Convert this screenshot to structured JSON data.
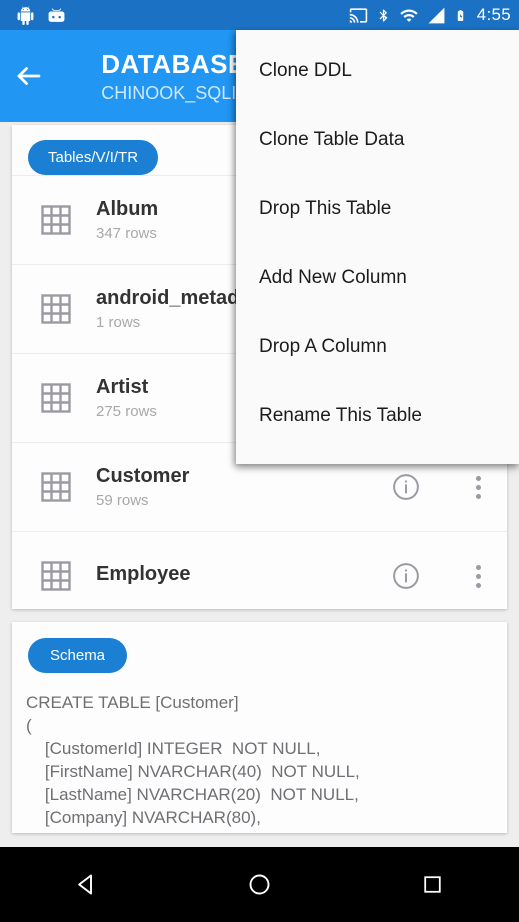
{
  "status_bar": {
    "notification_icons": [
      "android-robot-icon",
      "android-face-icon"
    ],
    "system_icons": [
      "cast-icon",
      "bluetooth-icon",
      "wifi-icon",
      "signal-icon",
      "battery-charging-icon"
    ],
    "time": "4:55",
    "background_color": "#1b72c4"
  },
  "app_bar": {
    "back_icon": "arrow-back-icon",
    "title": "DATABASE",
    "subtitle": "CHINOOK_SQLITE_AUTOINCREMENT_PKS.sqlite",
    "background_color": "#2196f3"
  },
  "tables_card": {
    "chip_label": "Tables/V/I/TR",
    "rows": [
      {
        "name": "Album",
        "subtitle": "347 rows",
        "icon": "table-grid-icon"
      },
      {
        "name": "android_metadata",
        "subtitle": "1 rows",
        "icon": "table-grid-icon"
      },
      {
        "name": "Artist",
        "subtitle": "275 rows",
        "icon": "table-grid-icon"
      },
      {
        "name": "Customer",
        "subtitle": "59 rows",
        "icon": "table-grid-icon"
      },
      {
        "name": "Employee",
        "subtitle": "",
        "icon": "table-grid-icon"
      }
    ],
    "row_action_icons": [
      "info-icon",
      "overflow-menu-icon"
    ]
  },
  "schema_card": {
    "chip_label": "Schema",
    "sql": "CREATE TABLE [Customer]\n(\n    [CustomerId] INTEGER  NOT NULL,\n    [FirstName] NVARCHAR(40)  NOT NULL,\n    [LastName] NVARCHAR(20)  NOT NULL,\n    [Company] NVARCHAR(80),"
  },
  "fab": {
    "label": "+",
    "icon": "plus-icon",
    "color": "#dd38e8"
  },
  "popup_menu": {
    "items": [
      {
        "label": "Clone DDL"
      },
      {
        "label": "Clone Table Data"
      },
      {
        "label": "Drop This Table"
      },
      {
        "label": "Add New Column"
      },
      {
        "label": "Drop A Column"
      },
      {
        "label": "Rename This Table"
      }
    ]
  },
  "nav_bar": {
    "back_icon": "nav-back-icon",
    "home_icon": "nav-home-icon",
    "recents_icon": "nav-recents-icon"
  }
}
